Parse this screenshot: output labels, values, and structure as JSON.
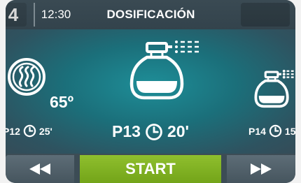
{
  "header": {
    "program_number": "4",
    "time": "12:30",
    "title": "DOSIFICACIÓN"
  },
  "carousel": {
    "left": {
      "program": "P12",
      "duration": "25'",
      "temperature": "65º",
      "icon": "steam-icon"
    },
    "center": {
      "program": "P13",
      "duration": "20'",
      "icon": "spray-bottle-icon"
    },
    "right": {
      "program": "P14",
      "duration": "15",
      "icon": "spray-bottle-icon"
    }
  },
  "footer": {
    "start_label": "START",
    "prev_icon": "rewind-icon",
    "next_icon": "fast-forward-icon"
  },
  "colors": {
    "accent_green": "#7fb224",
    "teal": "#1e8e98",
    "panel": "#3c4c55"
  }
}
